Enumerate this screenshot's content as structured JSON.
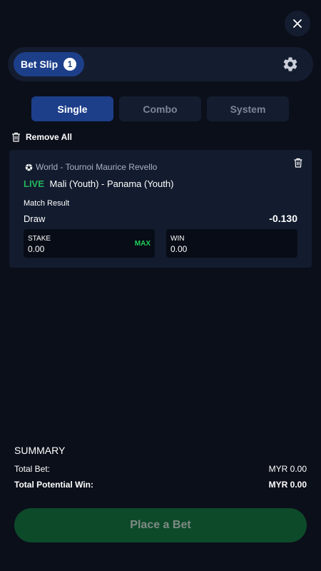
{
  "colors": {
    "background": "#0b0f1a",
    "panel": "#141d30",
    "card": "#131c2e",
    "accent_blue": "#1d3f8a",
    "live_green": "#23b55c",
    "max_green": "#1fce5a",
    "place_bet_bg": "#0d4a2a"
  },
  "header": {
    "close_icon": "close-icon",
    "betslip_label": "Bet Slip",
    "betslip_count": "1",
    "settings_icon": "gear-icon"
  },
  "tabs": [
    {
      "label": "Single",
      "active": true
    },
    {
      "label": "Combo",
      "active": false
    },
    {
      "label": "System",
      "active": false
    }
  ],
  "remove_all_label": "Remove All",
  "bet": {
    "league": "World - Tournoi Maurice Revello",
    "live_label": "LIVE",
    "match": "Mali (Youth) - Panama (Youth)",
    "market": "Match Result",
    "selection": "Draw",
    "odds": "-0.130",
    "stake": {
      "label": "STAKE",
      "value": "0.00",
      "max_label": "MAX"
    },
    "win": {
      "label": "WIN",
      "value": "0.00"
    }
  },
  "summary": {
    "title": "SUMMARY",
    "total_bet_label": "Total Bet:",
    "total_bet_value": "MYR 0.00",
    "potential_win_label": "Total Potential Win:",
    "potential_win_value": "MYR 0.00"
  },
  "place_bet_label": "Place a Bet"
}
